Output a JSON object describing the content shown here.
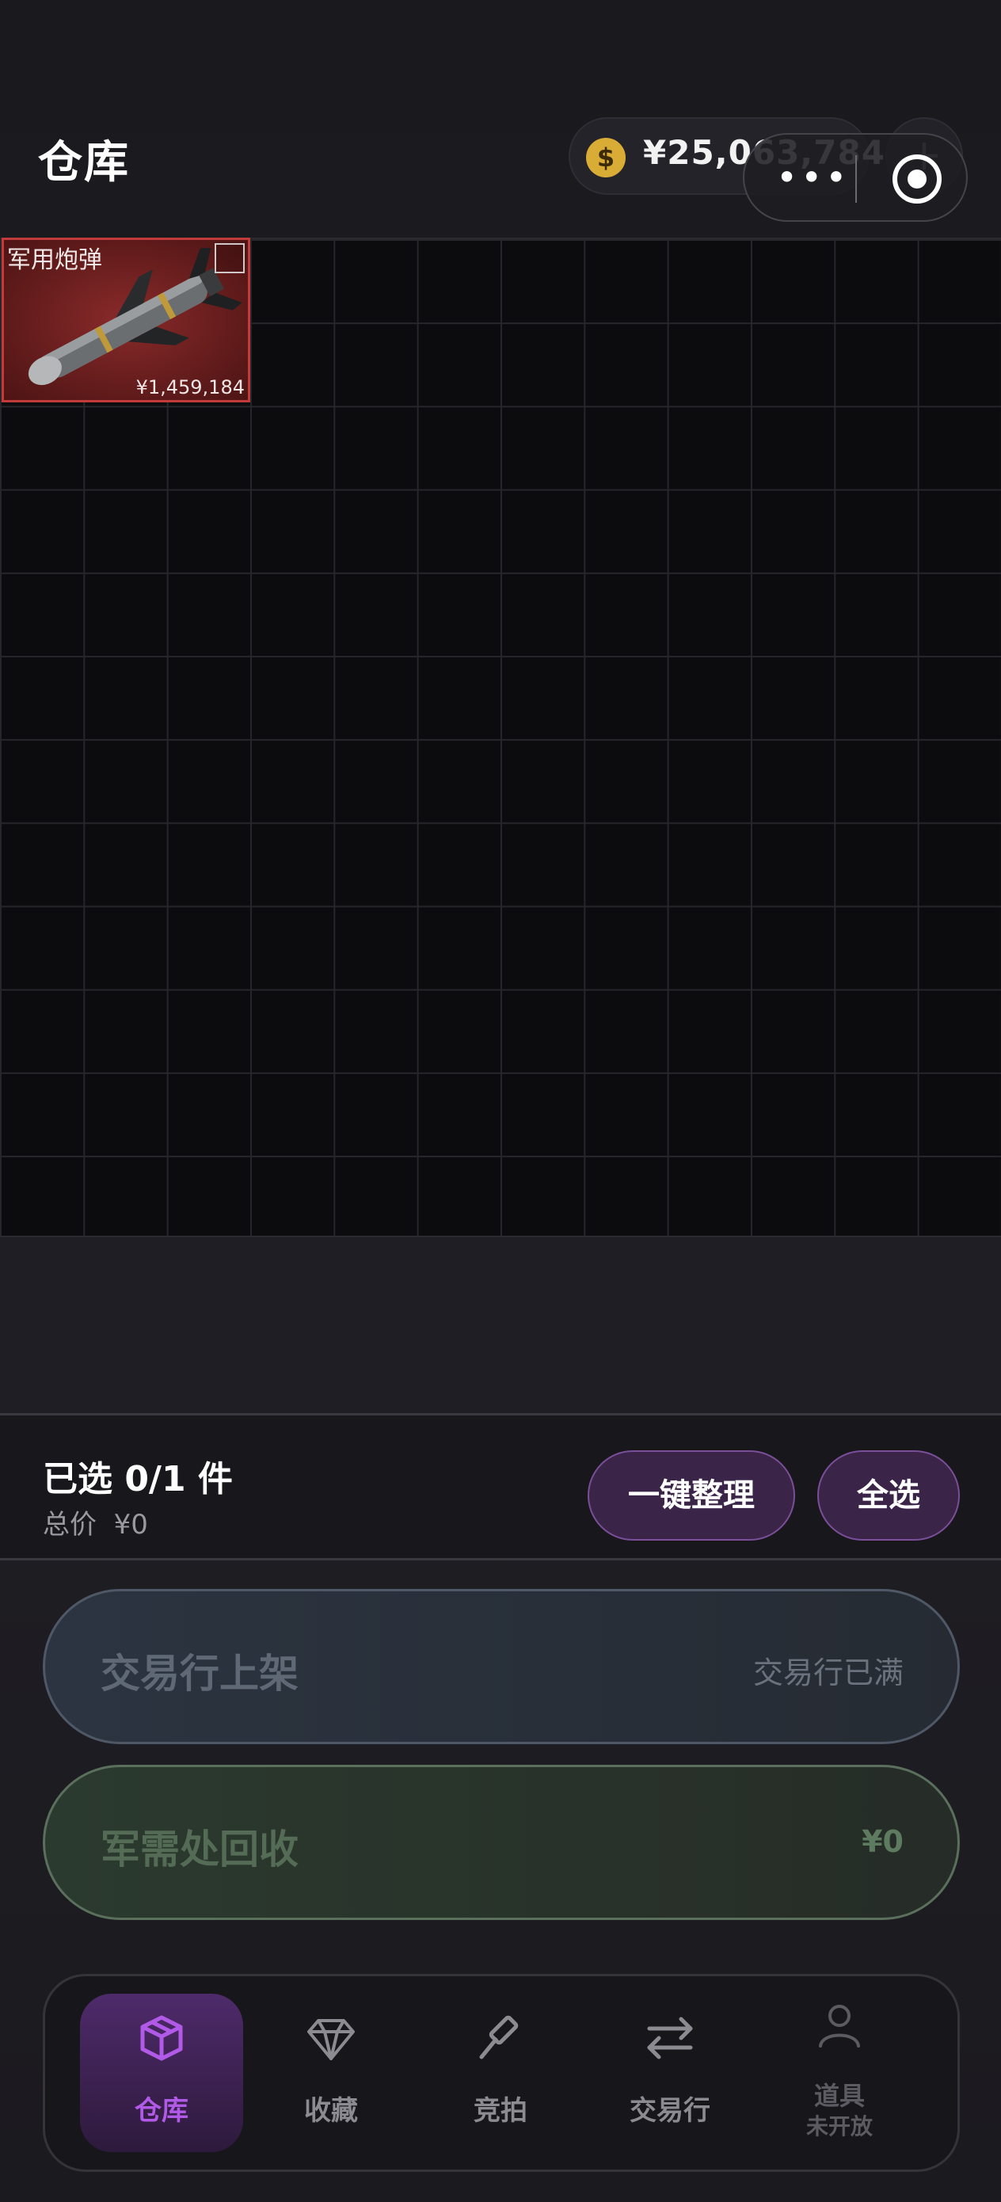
{
  "header": {
    "title": "仓库",
    "coin_symbol": "$",
    "balance": "¥25,063,784",
    "add_symbol": "+",
    "capsule_more": "•••"
  },
  "inventory": {
    "items": [
      {
        "name": "军用炮弹",
        "price": "¥1,459,184"
      }
    ]
  },
  "selection": {
    "count_text": "已选 0/1 件",
    "total_label": "总价",
    "total_value": "¥0",
    "sort_label": "一键整理",
    "select_all_label": "全选"
  },
  "actions": {
    "market": {
      "label": "交易行上架",
      "status": "交易行已满"
    },
    "recycle": {
      "label": "军需处回收",
      "value": "¥0"
    }
  },
  "nav": {
    "items": [
      {
        "label": "仓库",
        "icon": "cube-icon",
        "active": true
      },
      {
        "label": "收藏",
        "icon": "diamond-icon"
      },
      {
        "label": "竞拍",
        "icon": "gavel-icon"
      },
      {
        "label": "交易行",
        "icon": "swap-icon"
      },
      {
        "label": "道具",
        "sub": "未开放",
        "icon": "user-icon",
        "disabled": true
      }
    ]
  },
  "colors": {
    "accent": "#b25ae8",
    "item_rarity": "#c23a3a",
    "coin": "#d8ac35"
  }
}
